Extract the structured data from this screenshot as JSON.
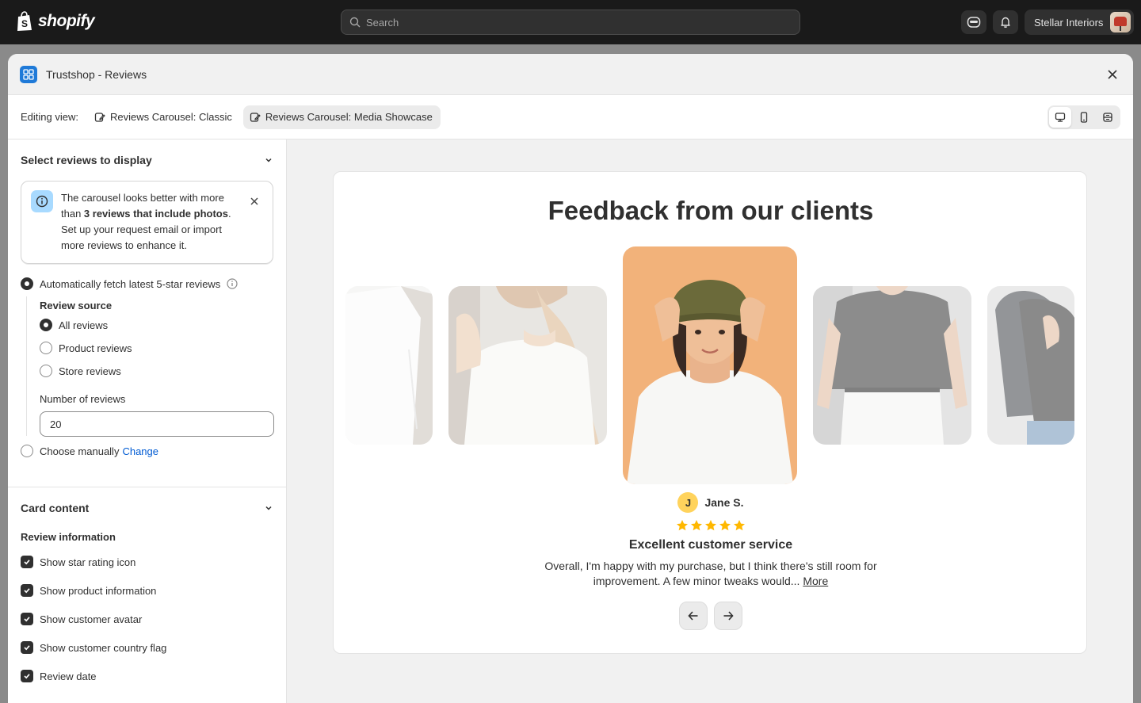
{
  "topbar": {
    "brand": "shopify",
    "search_placeholder": "Search",
    "store_name": "Stellar Interiors"
  },
  "modal": {
    "title": "Trustshop - Reviews",
    "editing_label": "Editing view:",
    "views": [
      {
        "label": "Reviews Carousel: Classic",
        "active": false
      },
      {
        "label": "Reviews Carousel: Media Showcase",
        "active": true
      }
    ],
    "devices": [
      "desktop-icon",
      "mobile-icon",
      "fullscreen-icon"
    ]
  },
  "sidebar": {
    "select_section": {
      "title": "Select reviews to display",
      "banner": {
        "line1": "The carousel looks better with more than ",
        "bold": "3 reviews that include photos",
        "line2": ". Set up your request email or import more reviews to enhance it."
      },
      "auto_fetch_label": "Automatically fetch latest 5-star reviews",
      "source_label": "Review source",
      "sources": [
        {
          "label": "All reviews",
          "selected": true
        },
        {
          "label": "Product reviews",
          "selected": false
        },
        {
          "label": "Store reviews",
          "selected": false
        }
      ],
      "count_label": "Number of reviews",
      "count_value": "20",
      "manual_label": "Choose manually",
      "manual_link": "Change"
    },
    "card_section": {
      "title": "Card content",
      "subtitle": "Review information",
      "options": [
        {
          "label": "Show star rating icon",
          "checked": true
        },
        {
          "label": "Show product information",
          "checked": true
        },
        {
          "label": "Show customer avatar",
          "checked": true
        },
        {
          "label": "Show customer country flag",
          "checked": true
        },
        {
          "label": "Review date",
          "checked": true
        }
      ]
    }
  },
  "preview": {
    "heading": "Feedback from our clients",
    "reviewer_initial": "J",
    "reviewer_name": "Jane S.",
    "rating": 5,
    "review_title": "Excellent customer service",
    "review_body": "Overall, I'm happy with my purchase, but I think there's still room for improvement. A few minor tweaks would... ",
    "more_label": "More",
    "colors": {
      "star": "#ffb800",
      "accent_bg": "#f2b27a",
      "avatar_bg": "#ffd35c"
    }
  }
}
